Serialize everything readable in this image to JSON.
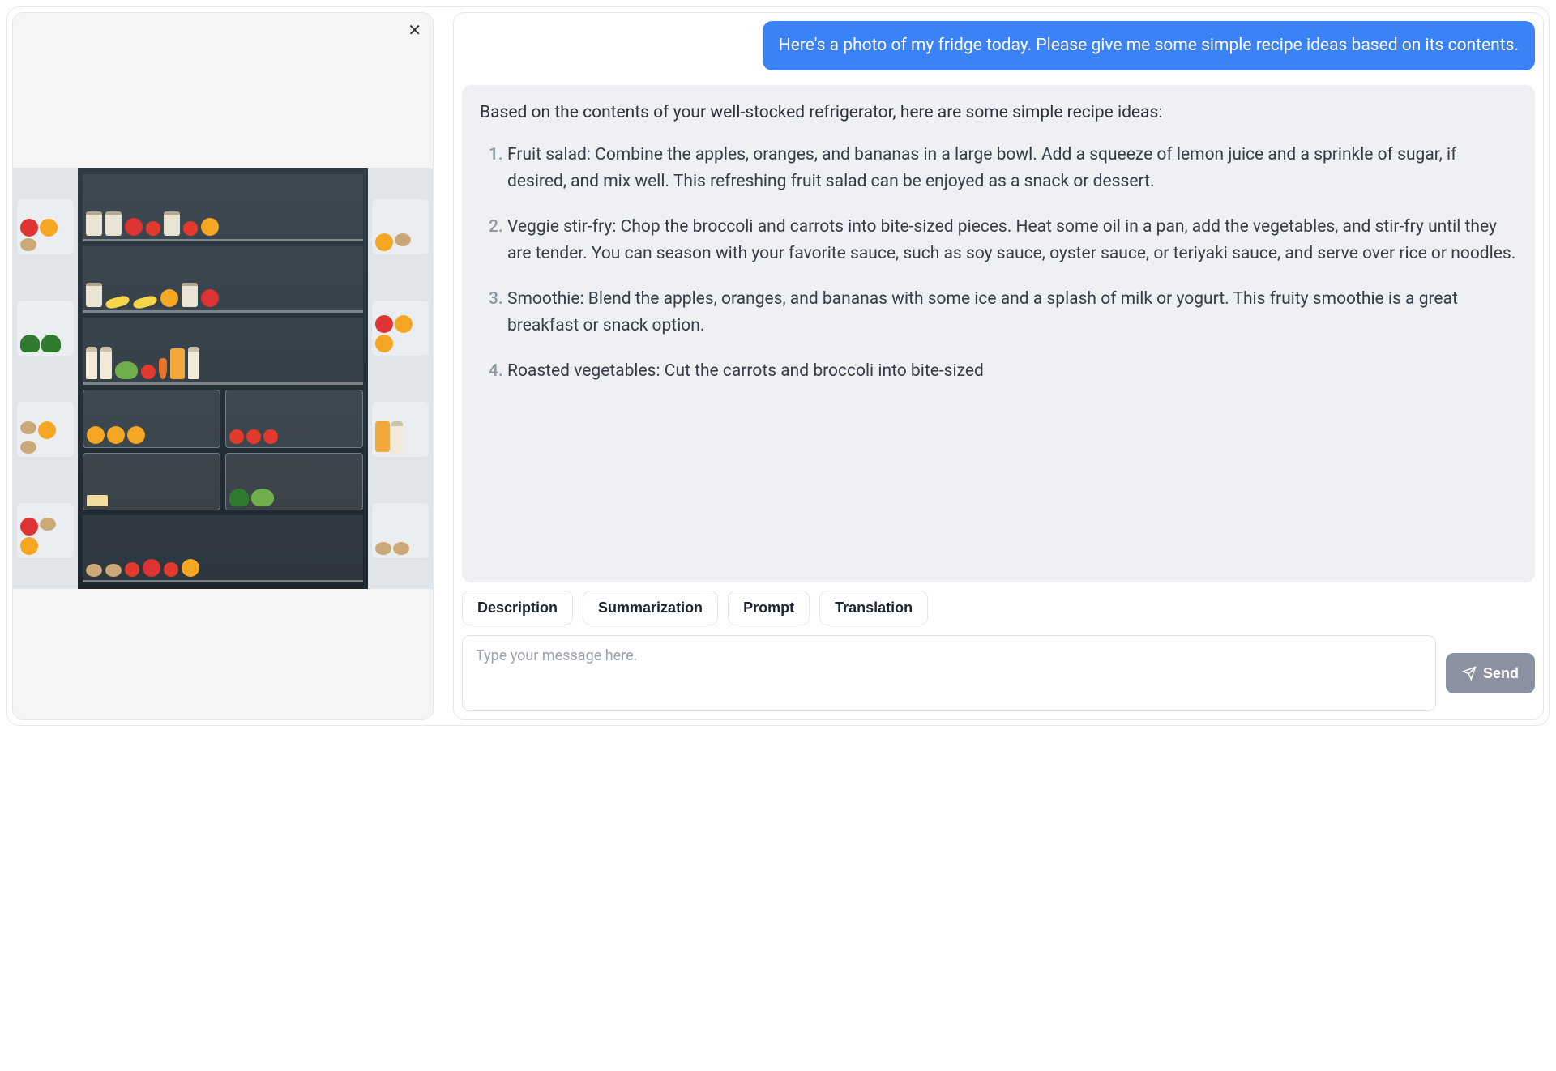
{
  "image_panel": {
    "close_glyph": "✕",
    "alt": "Open refrigerator stocked with fruits, vegetables, jars and bottles"
  },
  "chat": {
    "user_message": "Here's a photo of my fridge today. Please give me some simple recipe ideas based on its contents.",
    "assistant_intro": "Based on the contents of your well-stocked refrigerator, here are some simple recipe ideas:",
    "assistant_items": [
      "Fruit salad: Combine the apples, oranges, and bananas in a large bowl. Add a squeeze of lemon juice and a sprinkle of sugar, if desired, and mix well. This refreshing fruit salad can be enjoyed as a snack or dessert.",
      "Veggie stir-fry: Chop the broccoli and carrots into bite-sized pieces. Heat some oil in a pan, add the vegetables, and stir-fry until they are tender. You can season with your favorite sauce, such as soy sauce, oyster sauce, or teriyaki sauce, and serve over rice or noodles.",
      "Smoothie: Blend the apples, oranges, and bananas with some ice and a splash of milk or yogurt. This fruity smoothie is a great breakfast or snack option.",
      "Roasted vegetables: Cut the carrots and broccoli into bite-sized"
    ]
  },
  "suggestions": {
    "description": "Description",
    "summarization": "Summarization",
    "prompt": "Prompt",
    "translation": "Translation"
  },
  "compose": {
    "placeholder": "Type your message here.",
    "send_label": "Send"
  }
}
